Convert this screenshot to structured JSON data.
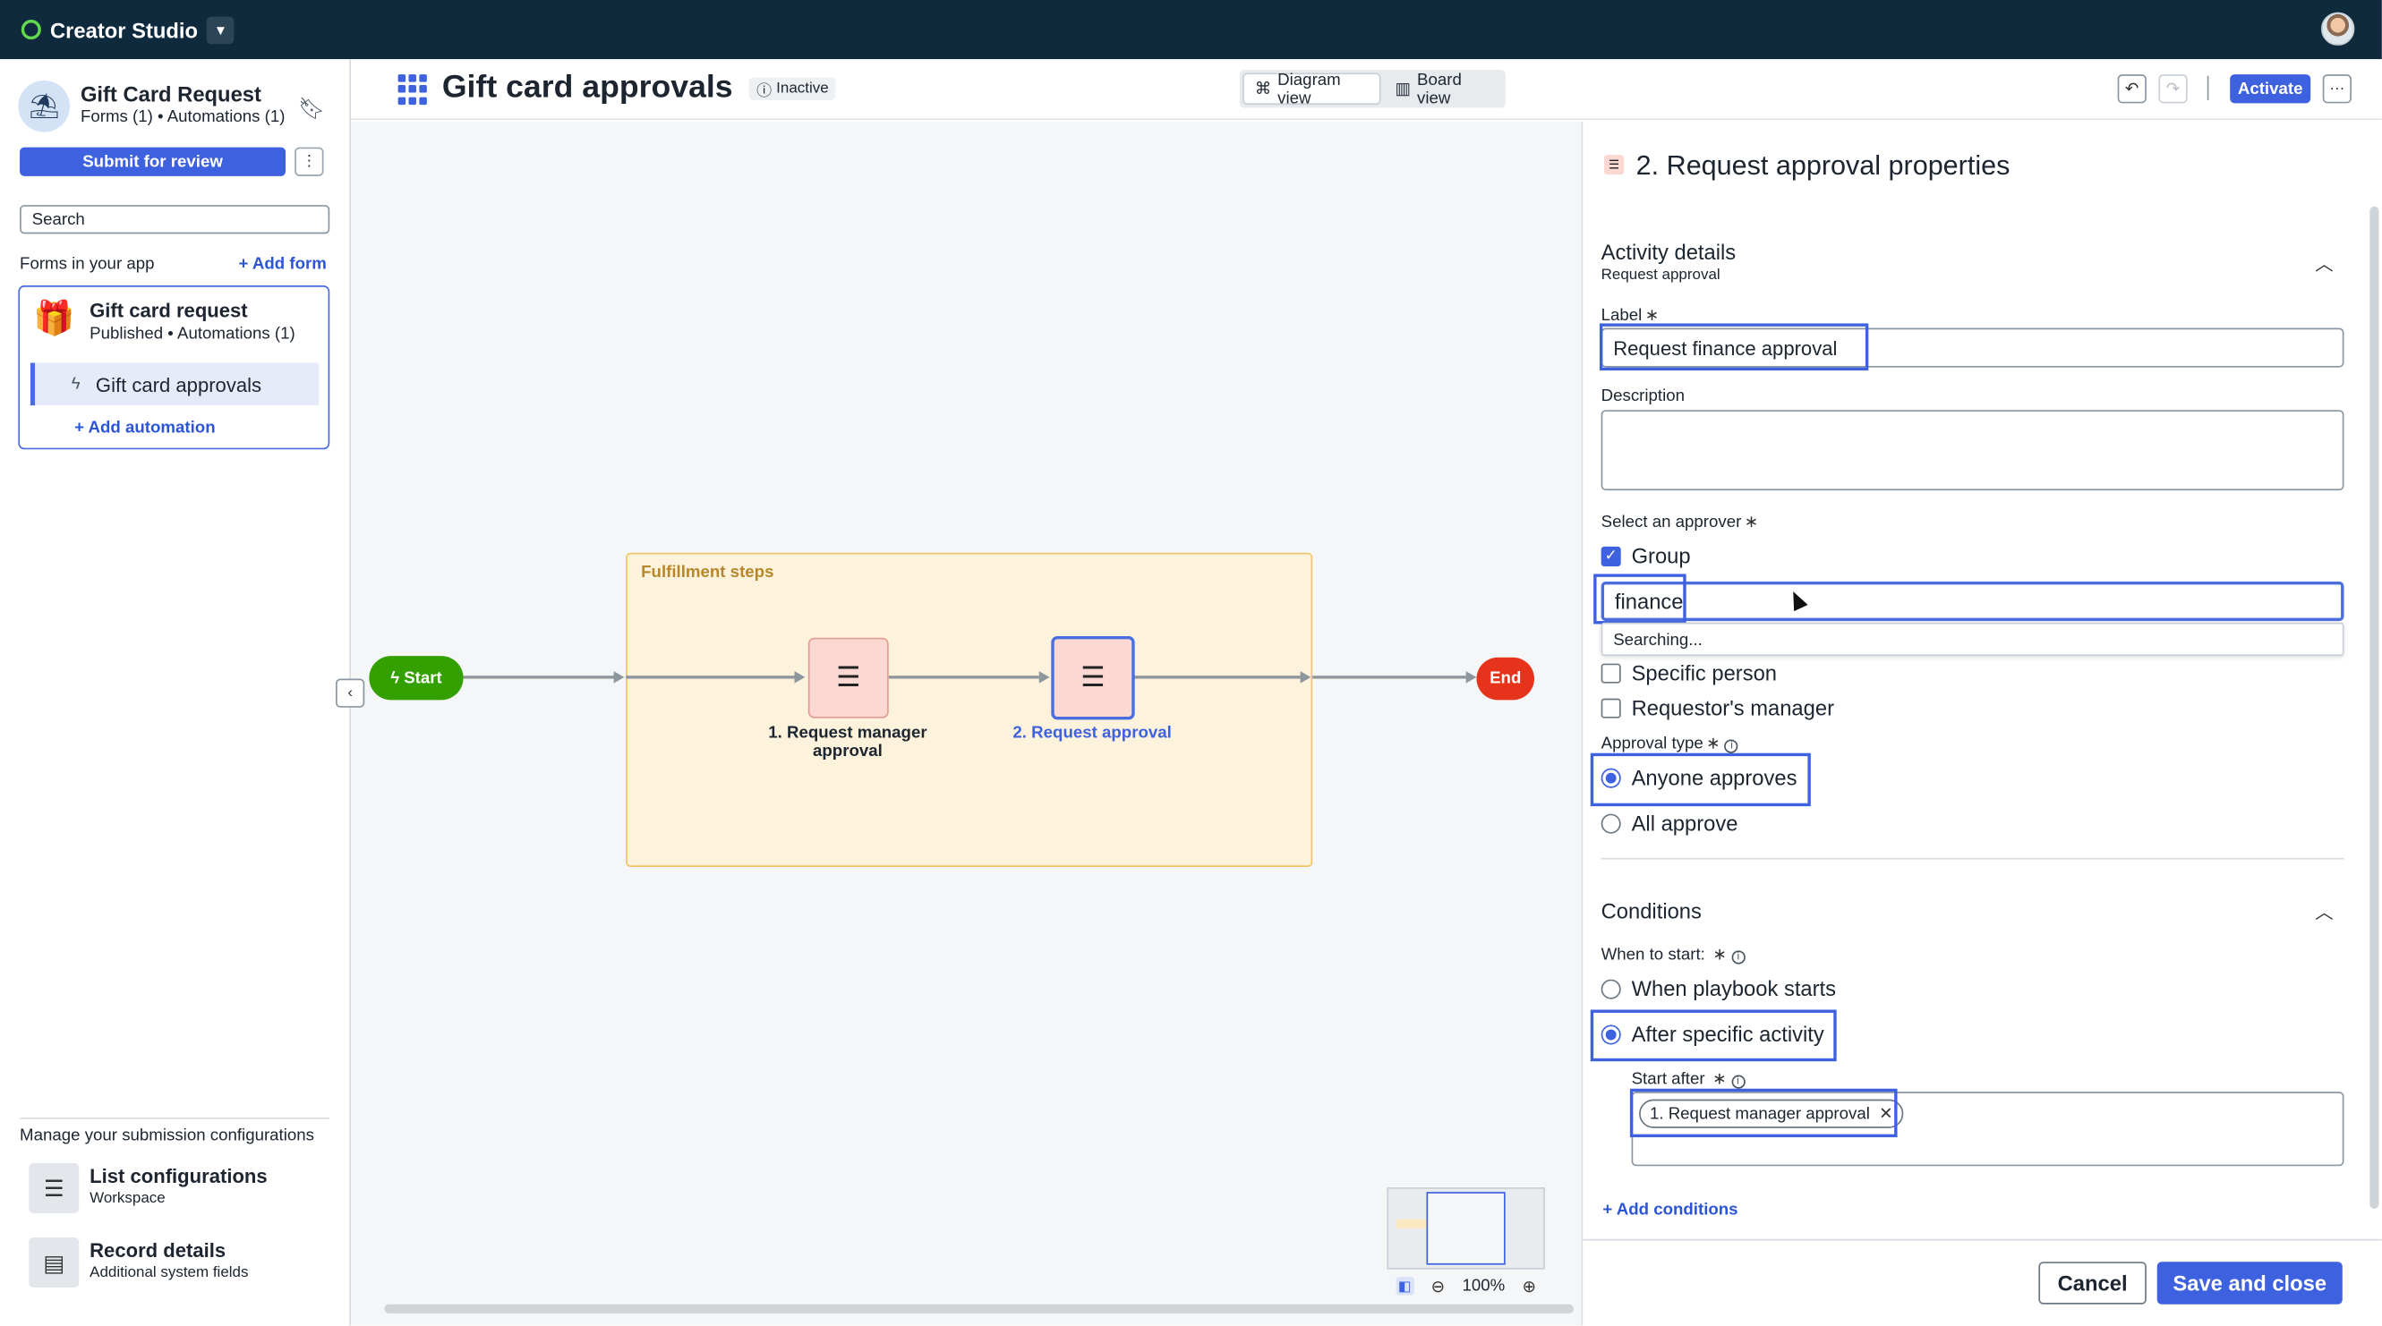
{
  "topbar": {
    "app_name": "Creator Studio"
  },
  "sidebar": {
    "app_title": "Gift Card Request",
    "app_subtitle": "Forms (1) • Automations (1)",
    "submit_label": "Submit for review",
    "search_placeholder": "Search",
    "forms_label": "Forms in your app",
    "add_form_label": "+ Add form",
    "form": {
      "title": "Gift card request",
      "subtitle": "Published • Automations (1)",
      "automation": "Gift card approvals",
      "add_automation_label": "+ Add automation"
    },
    "manage_label": "Manage your submission configurations",
    "items": [
      {
        "title": "List configurations",
        "subtitle": "Workspace"
      },
      {
        "title": "Record details",
        "subtitle": "Additional system fields"
      }
    ]
  },
  "canvas_header": {
    "title": "Gift card approvals",
    "status": "Inactive",
    "views": [
      "Diagram view",
      "Board view"
    ],
    "active_view": "Diagram view",
    "activate_label": "Activate"
  },
  "diagram": {
    "lane_label": "Fulfillment steps",
    "start_label": "Start",
    "end_label": "End",
    "tasks": [
      {
        "label": "1. Request manager approval"
      },
      {
        "label": "2. Request approval"
      }
    ],
    "zoom": "100%"
  },
  "panel": {
    "title": "2. Request approval properties",
    "activity": {
      "section_title": "Activity details",
      "section_subtitle": "Request approval",
      "label_field": "Label",
      "label_value": "Request finance approval",
      "description_field": "Description",
      "description_value": "",
      "approver_field": "Select an approver",
      "group_label": "Group",
      "group_value": "finance",
      "searching_text": "Searching...",
      "specific_person_label": "Specific person",
      "requestors_manager_label": "Requestor's manager",
      "approval_type_field": "Approval type",
      "approval_options": [
        "Anyone approves",
        "All approve"
      ],
      "approval_selected": "Anyone approves"
    },
    "conditions": {
      "section_title": "Conditions",
      "when_field": "When to start:",
      "when_options": [
        "When playbook starts",
        "After specific activity"
      ],
      "when_selected": "After specific activity",
      "start_after_field": "Start after",
      "start_after_chip": "1. Request manager approval",
      "add_conditions_label": "+ Add conditions"
    },
    "cancel_label": "Cancel",
    "save_label": "Save and close"
  },
  "colors": {
    "topbar": "#0e2a3c",
    "accent": "#3e61e0",
    "start_node": "#34a000",
    "end_node": "#e6341c",
    "lane": "#fdf3dd",
    "task_node": "#fcd8d2"
  }
}
